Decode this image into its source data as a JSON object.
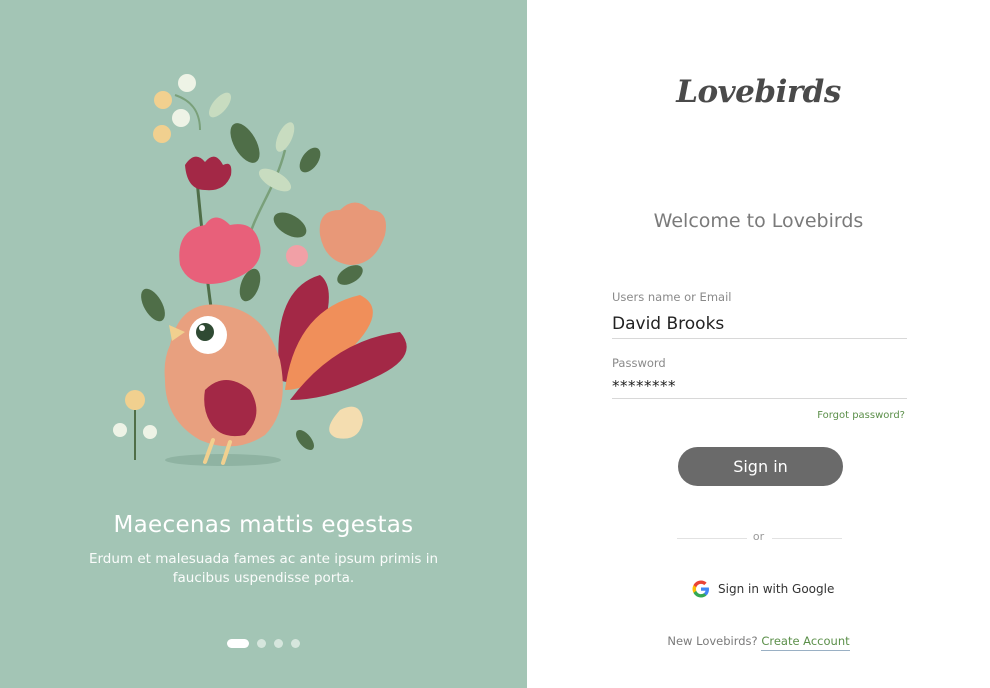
{
  "colors": {
    "left_panel_bg": "#a3c5b5",
    "button_bg": "#6a6a6a",
    "link_green": "#5b8f49",
    "bird_body": "#e8a07f",
    "flower_red": "#a32846",
    "flower_pink": "#e8607a",
    "leaf_green": "#4f6e48"
  },
  "illustration": {
    "name": "bird-flowers-illustration"
  },
  "promo": {
    "title": "Maecenas mattis egestas",
    "text": "Erdum et malesuada fames ac ante ipsum primis in faucibus uspendisse porta."
  },
  "carousel": {
    "slides_count": 4,
    "active_index": 0
  },
  "brand": {
    "logo_text": "Lovebirds"
  },
  "welcome": {
    "title": "Welcome to Lovebirds"
  },
  "form": {
    "username_label": "Users name or Email",
    "username_value": "David Brooks",
    "password_label": "Password",
    "password_value": "********",
    "forgot_label": "Forgot password?",
    "signin_label": "Sign in",
    "or_label": "or",
    "google_label": "Sign in with Google",
    "google_icon": "google-g-icon"
  },
  "footer": {
    "prompt": "New Lovebirds?",
    "create_label": "Create Account"
  }
}
